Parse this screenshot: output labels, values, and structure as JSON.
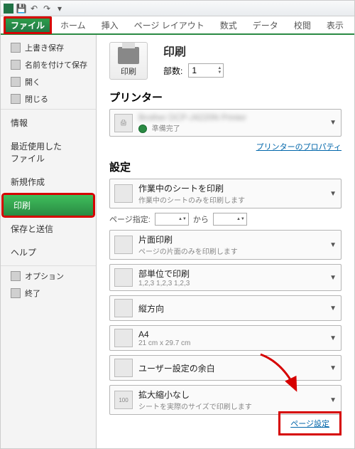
{
  "qat": {
    "save_tip": "保存",
    "undo_tip": "元に戻す",
    "redo_tip": "やり直し"
  },
  "ribbon": {
    "file": "ファイル",
    "tabs": [
      "ホーム",
      "挿入",
      "ページ レイアウト",
      "数式",
      "データ",
      "校閲",
      "表示"
    ]
  },
  "sidebar": {
    "savecopy": "上書き保存",
    "saveas": "名前を付けて保存",
    "open": "開く",
    "close": "閉じる",
    "info": "情報",
    "recent": "最近使用した\nファイル",
    "new": "新規作成",
    "print": "印刷",
    "save_send": "保存と送信",
    "help": "ヘルプ",
    "options": "オプション",
    "exit": "終了"
  },
  "print_panel": {
    "button_label": "印刷",
    "title": "印刷",
    "copies_label": "部数:",
    "copies_value": "1"
  },
  "printer": {
    "section": "プリンター",
    "status": "準備完了",
    "props_link": "プリンターのプロパティ"
  },
  "settings": {
    "section": "設定",
    "sheet": {
      "t1": "作業中のシートを印刷",
      "t2": "作業中のシートのみを印刷します"
    },
    "page_range_label": "ページ指定:",
    "page_range_to": "から",
    "duplex": {
      "t1": "片面印刷",
      "t2": "ページの片面のみを印刷します"
    },
    "collate": {
      "t1": "部単位で印刷",
      "t2": "1,2,3    1,2,3    1,2,3"
    },
    "portrait": {
      "t1": "縦方向",
      "t2": ""
    },
    "paper": {
      "t1": "A4",
      "t2": "21 cm x 29.7 cm"
    },
    "margins": {
      "t1": "ユーザー設定の余白",
      "t2": ""
    },
    "scaling": {
      "t1": "拡大縮小なし",
      "t2": "シートを実際のサイズで印刷します",
      "badge": "100"
    },
    "page_setup_link": "ページ設定"
  }
}
